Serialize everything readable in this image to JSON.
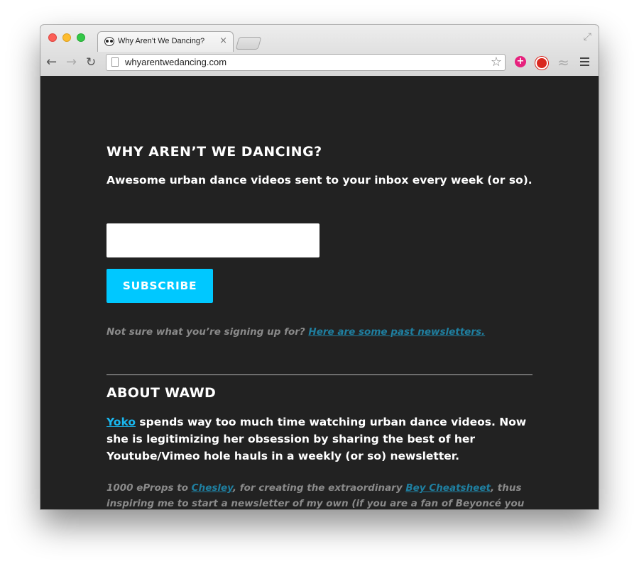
{
  "browser": {
    "tab_title": "Why Aren’t We Dancing?",
    "tab_close": "×",
    "url": "whyarentwedancing.com",
    "nav": {
      "back": "←",
      "forward": "→",
      "reload": "↻"
    },
    "star": "☆",
    "ext_plus": "+",
    "ext_wave": "≈",
    "fullscreen": "⤢"
  },
  "page": {
    "title": "WHY AREN’T WE DANCING?",
    "tagline": "Awesome urban dance videos sent to your inbox every week (or so).",
    "email_value": "",
    "subscribe_label": "SUBSCRIBE",
    "past_prefix": "Not sure what you’re signing up for? ",
    "past_link": "Here are some past newsletters.",
    "about_heading": "ABOUT WAWD",
    "about_link": "Yoko",
    "about_text": " spends way too much time watching urban dance videos. Now she is legitimizing her obsession by sharing the best of her Youtube/Vimeo hole hauls in a weekly (or so) newsletter.",
    "credit_prefix": "1000 eProps to ",
    "credit_link1": "Chesley",
    "credit_mid": ", for creating the extraordinary ",
    "credit_link2": "Bey Cheatsheet",
    "credit_suffix": ", thus inspiring me to start a newsletter of my own (if you are a fan of Beyoncé you MUST sign up for"
  },
  "colors": {
    "background": "#222222",
    "accent": "#00c8ff",
    "link": "#1f7fa0"
  }
}
